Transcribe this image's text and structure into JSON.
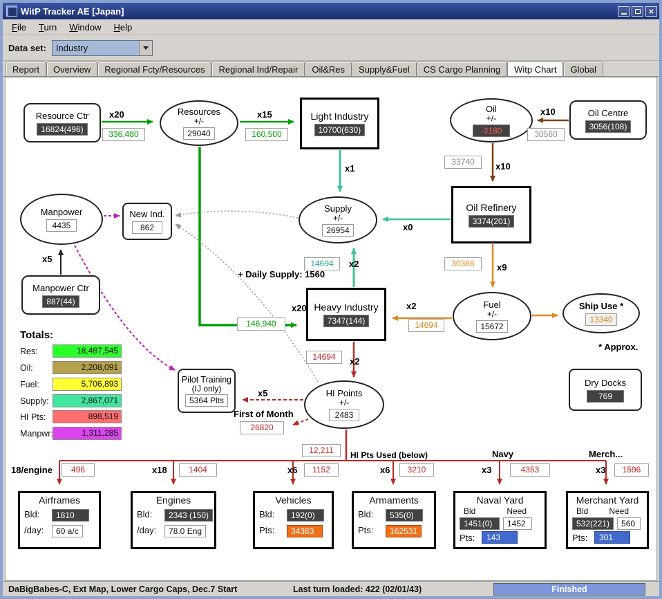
{
  "window": {
    "title": "WitP Tracker AE [Japan]"
  },
  "menu": [
    "File",
    "Turn",
    "Window",
    "Help"
  ],
  "dataset": {
    "label": "Data set:",
    "value": "Industry"
  },
  "tabs": [
    "Report",
    "Overview",
    "Regional Fcty/Resources",
    "Regional Ind/Repair",
    "Oil&Res",
    "Supply&Fuel",
    "CS Cargo Planning",
    "Witp Chart",
    "Global"
  ],
  "nodes": {
    "resource_ctr": {
      "title": "Resource Ctr",
      "value": "16824(496)"
    },
    "resources": {
      "title": "Resources",
      "sub": "+/-",
      "value": "29040"
    },
    "light_industry": {
      "title": "Light Industry",
      "value": "10700(630)"
    },
    "oil": {
      "title": "Oil",
      "sub": "+/-",
      "value": "-3180"
    },
    "oil_centre": {
      "title": "Oil Centre",
      "value": "3056(108)"
    },
    "supply": {
      "title": "Supply",
      "sub": "+/-",
      "value": "26954"
    },
    "oil_refinery": {
      "title": "Oil Refinery",
      "value": "3374(201)"
    },
    "manpower": {
      "title": "Manpower",
      "value": "4435"
    },
    "new_ind": {
      "title": "New Ind.",
      "value": "862"
    },
    "manpower_ctr": {
      "title": "Manpower Ctr",
      "value": "887(44)"
    },
    "heavy_industry": {
      "title": "Heavy Industry",
      "value": "7347(144)"
    },
    "fuel": {
      "title": "Fuel",
      "sub": "+/-",
      "value": "15672"
    },
    "ship_use": {
      "title": "Ship Use *",
      "value": "13340",
      "footnote": "* Approx."
    },
    "pilot_training": {
      "title": "Pilot Training",
      "sub": "(IJ only)",
      "value": "5364 Plts"
    },
    "hi_points": {
      "title": "HI Points",
      "sub": "+/-",
      "value": "2483"
    },
    "dry_docks": {
      "title": "Dry Docks",
      "value": "769"
    },
    "first_of_month": {
      "title": "First of Month",
      "value": "26820"
    }
  },
  "edges": {
    "res_to_resources": {
      "mult": "x20",
      "value": "336,480"
    },
    "resources_to_light": {
      "mult": "x15",
      "value": "160,500"
    },
    "light_to_supply": {
      "mult": "x1"
    },
    "resources_to_heavy": {
      "mult": "x20",
      "value": "146,940"
    },
    "heavy_to_supply": {
      "mult": "x2",
      "value": "14694",
      "note": "+ Daily Supply: 1560"
    },
    "refinery_to_supply": {
      "mult": "x0"
    },
    "oilcentre_to_oil": {
      "mult": "x10",
      "value": "30560"
    },
    "oil_to_refinery": {
      "mult": "x10",
      "value": "33740"
    },
    "refinery_to_fuel": {
      "mult": "x9",
      "value": "30366"
    },
    "fuel_to_heavy": {
      "mult": "x2",
      "value": "14694"
    },
    "heavy_to_hipoints": {
      "mult": "x2",
      "value": "14694"
    },
    "hipoints_to_pilot": {
      "mult": "x5"
    },
    "manpowerctr_to_manpower": {
      "mult": "x5"
    }
  },
  "bottom": {
    "used_total": "12,211",
    "used_note": "HI Pts Used (below)",
    "navy": "Navy",
    "merch": "Merch..."
  },
  "totals": {
    "title": "Totals:",
    "rows": [
      {
        "label": "Res:",
        "value": "18,487,545",
        "color": "#2aff2a"
      },
      {
        "label": "Oil:",
        "value": "2,208,091",
        "color": "#b3a24b"
      },
      {
        "label": "Fuel:",
        "value": "5,706,893",
        "color": "#ffff33"
      },
      {
        "label": "Supply:",
        "value": "2,867,071",
        "color": "#3fe6a0"
      },
      {
        "label": "HI Pts:",
        "value": "898,519",
        "color": "#ff6e6e"
      },
      {
        "label": "Manpwr:",
        "value": "1,311,285",
        "color": "#dd44ee"
      }
    ]
  },
  "factories": {
    "airframes": {
      "mult": "18/engine",
      "used": "496",
      "title": "Airframes",
      "bld_label": "Bld:",
      "bld": "1810",
      "rate_label": "/day:",
      "rate": "60 a/c"
    },
    "engines": {
      "mult": "x18",
      "used": "1404",
      "title": "Engines",
      "bld_label": "Bld:",
      "bld": "2343 (150)",
      "rate_label": "/day:",
      "rate": "78.0 Eng"
    },
    "vehicles": {
      "mult": "x6",
      "used": "1152",
      "title": "Vehicles",
      "bld_label": "Bld:",
      "bld": "192(0)",
      "pts_label": "Pts:",
      "pts": "34383"
    },
    "armaments": {
      "mult": "x6",
      "used": "3210",
      "title": "Armaments",
      "bld_label": "Bld:",
      "bld": "535(0)",
      "pts_label": "Pts:",
      "pts": "162531"
    },
    "naval_yard": {
      "mult": "x3",
      "used": "4353",
      "title": "Naval Yard",
      "bld_label": "Bld",
      "need_label": "Need",
      "bld": "1451(0)",
      "need": "1452",
      "pts_label": "Pts:",
      "pts": "143"
    },
    "merchant_yard": {
      "mult": "x3",
      "used": "1596",
      "title": "Merchant Yard",
      "bld_label": "Bld",
      "need_label": "Need",
      "bld": "532(221)",
      "need": "560",
      "pts_label": "Pts:",
      "pts": "301"
    }
  },
  "status": {
    "left": "DaBigBabes-C, Ext Map, Lower Cargo Caps, Dec.7 Start",
    "center": "Last turn loaded: 422 (02/01/43)",
    "finished": "Finished"
  }
}
